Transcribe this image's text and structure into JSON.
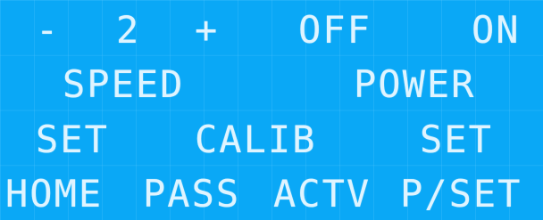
{
  "row1": {
    "minus": "-",
    "value": "2",
    "plus": "+",
    "off": "OFF",
    "on": "ON"
  },
  "row2": {
    "speed": "SPEED",
    "power": "POWER"
  },
  "row3": {
    "set_left": "SET",
    "calib": "CALIB",
    "set_right": "SET"
  },
  "row4": {
    "home": "HOME",
    "pass": "PASS",
    "actv": "ACTV",
    "pset": "P/SET"
  },
  "colors": {
    "screen_background": "#0aa8f6",
    "text": "#dff4ff"
  }
}
